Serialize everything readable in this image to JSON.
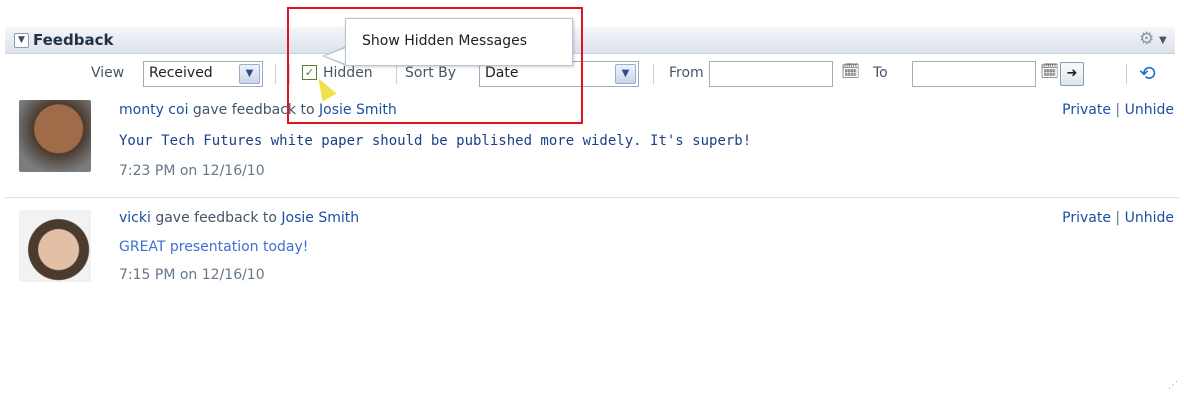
{
  "panel": {
    "title": "Feedback"
  },
  "toolbar": {
    "view_label": "View",
    "view_value": "Received",
    "hidden_label": "Hidden",
    "sortby_label": "Sort By",
    "sortby_value": "Date",
    "from_label": "From",
    "to_label": "To"
  },
  "tooltip": {
    "text": "Show Hidden Messages"
  },
  "feedback": [
    {
      "author": "monty coi",
      "action": " gave feedback to ",
      "recipient": "Josie Smith",
      "message": "Your Tech Futures white paper should be published more widely. It's superb!",
      "time": "7:23 PM on 12/16/10",
      "private_label": "Private",
      "unhide_label": "Unhide"
    },
    {
      "author": "vicki",
      "action": " gave feedback to ",
      "recipient": "Josie Smith",
      "message": "GREAT presentation today!",
      "time": "7:15 PM on 12/16/10",
      "private_label": "Private",
      "unhide_label": "Unhide"
    }
  ]
}
